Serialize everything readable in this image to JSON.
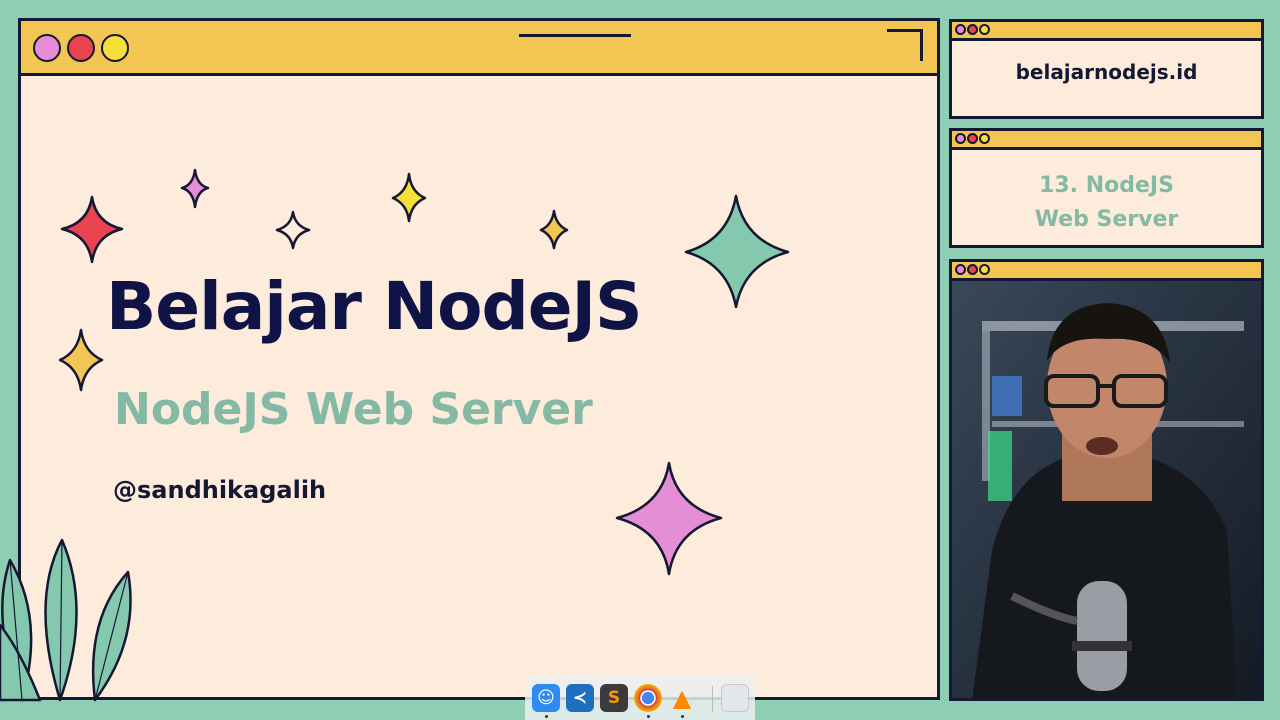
{
  "main_window": {
    "title_dots": [
      {
        "name": "pink-dot",
        "color": "#e58ed6"
      },
      {
        "name": "red-dot",
        "color": "#e8434e"
      },
      {
        "name": "yellow-dot",
        "color": "#f6df38"
      }
    ],
    "headline": "Belajar NodeJS",
    "subtitle": "NodeJS Web Server",
    "handle": "@sandhikagalih"
  },
  "sidebar": {
    "site": "belajarnodejs.id",
    "topic_line1": "13. NodeJS",
    "topic_line2": "Web Server"
  },
  "colors": {
    "background": "#8ecfb4",
    "window_fill": "#fdebdc",
    "titlebar": "#f3c552",
    "outline": "#141833",
    "headline": "#0f1346",
    "accent_green": "#84b9a4"
  },
  "dock": {
    "items": [
      {
        "name": "finder-icon",
        "color": "#2d8cf0",
        "glyph": "☺"
      },
      {
        "name": "vscode-icon",
        "color": "#1f6fc0",
        "glyph": "≺"
      },
      {
        "name": "sublime-text-icon",
        "color": "#3b3b3b",
        "glyph": "S"
      },
      {
        "name": "chrome-icon",
        "color": "#ffffff",
        "glyph": ""
      },
      {
        "name": "vlc-icon",
        "color": "#ff8800",
        "glyph": "▲"
      },
      {
        "name": "trash-icon",
        "color": "#e4e7ea",
        "glyph": ""
      }
    ]
  }
}
